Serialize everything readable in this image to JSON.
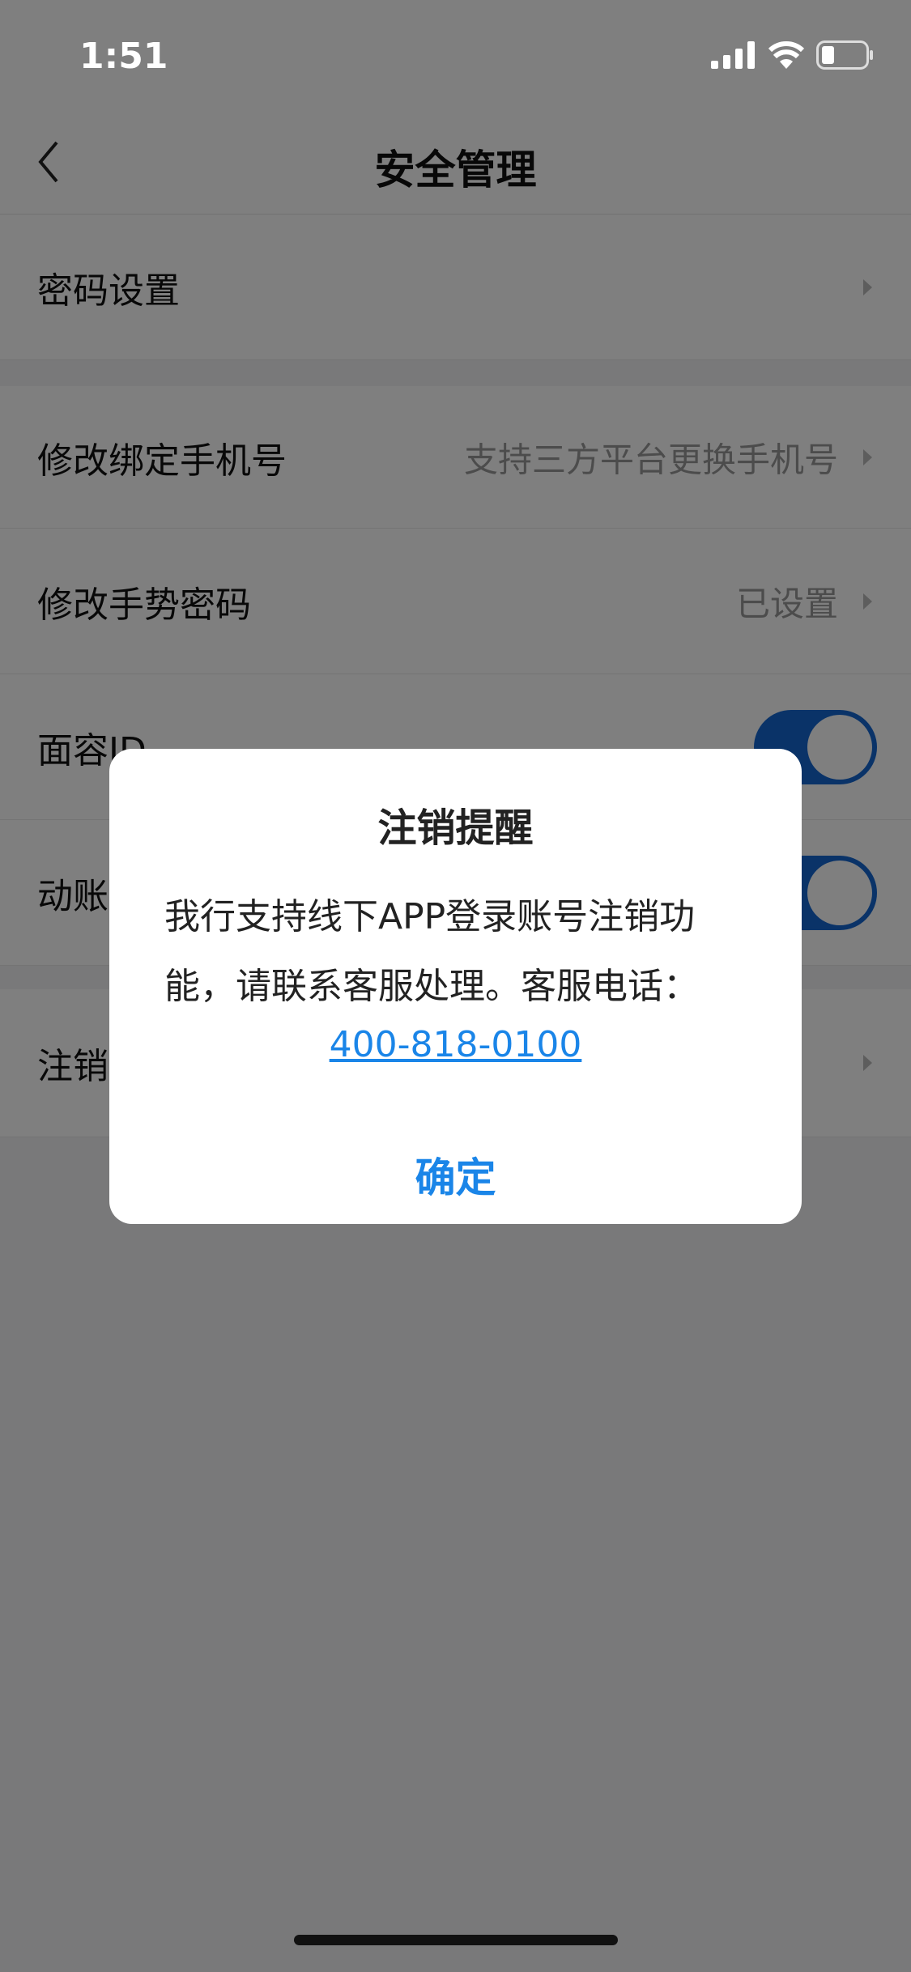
{
  "status_bar": {
    "time": "1:51",
    "icons": [
      "signal-icon",
      "wifi-icon",
      "battery-icon"
    ],
    "battery_level": 0.25
  },
  "nav": {
    "title": "安全管理",
    "back_icon": "chevron-left-icon"
  },
  "rows": [
    {
      "label": "密码设置",
      "value": ""
    },
    {
      "label": "修改绑定手机号",
      "value": "支持三方平台更换手机号"
    },
    {
      "label": "修改手势密码",
      "value": "已设置"
    },
    {
      "label": "面容ID",
      "toggle": true
    },
    {
      "label": "动账",
      "toggle": true
    },
    {
      "label": "注销",
      "value": ""
    }
  ],
  "dialog": {
    "title": "注销提醒",
    "body": "我行支持线下APP登录账号注销功能，请联系客服处理。客服电话：",
    "phone": "400-818-0100",
    "confirm": "确定"
  },
  "colors": {
    "accent": "#1a85e8",
    "toggle_on": "#1466d0"
  }
}
